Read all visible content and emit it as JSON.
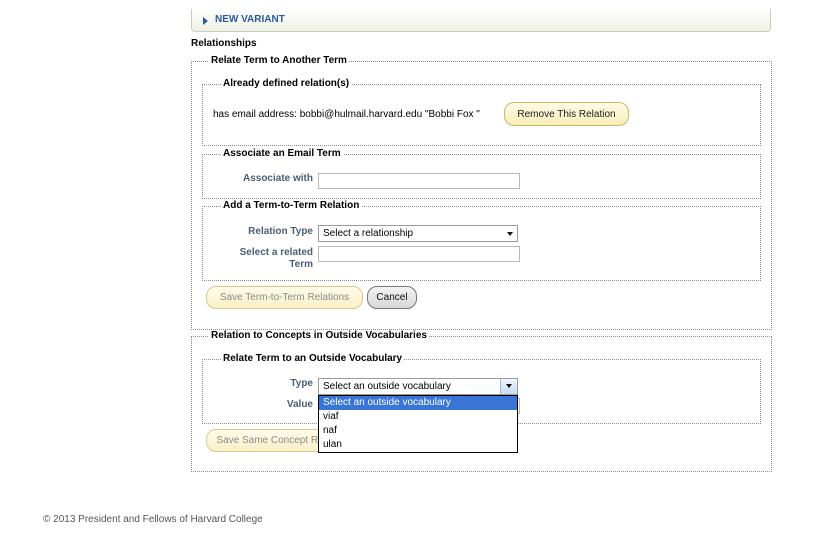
{
  "variant_bar": {
    "label": "NEW VARIANT"
  },
  "relationships_title": "Relationships",
  "relate_term": {
    "legend": "Relate Term to Another Term",
    "defined": {
      "legend": "Already defined relation(s)",
      "relation_text": "has email address: bobbi@hulmail.harvard.edu \"Bobbi Fox \"",
      "remove_button": "Remove This Relation"
    },
    "email": {
      "legend": "Associate an Email Term",
      "associate_label": "Associate with",
      "associate_value": ""
    },
    "term_to_term": {
      "legend": "Add a Term-to-Term Relation",
      "relation_type_label": "Relation Type",
      "relation_type_selected": "Select a relationship",
      "related_term_label": "Select a related Term",
      "related_term_value": ""
    },
    "save_button": "Save Term-to-Term Relations",
    "cancel_button": "Cancel"
  },
  "outside_vocab": {
    "legend": "Relation to Concepts in Outside Vocabularies",
    "inner_legend": "Relate Term to an Outside Vocabulary",
    "type_label": "Type",
    "type_selected": "Select an outside vocabulary",
    "value_label": "Value",
    "options": [
      "Select an outside vocabulary",
      "viaf",
      "naf",
      "ulan"
    ],
    "save_button": "Save Same Concept Relations"
  },
  "footer": "© 2013 President and Fellows of Harvard College",
  "colors": {
    "link": "#2b5a9c",
    "label": "#4b5f72",
    "highlight": "#3875d7",
    "button_yellow": "#f7eeb8"
  }
}
